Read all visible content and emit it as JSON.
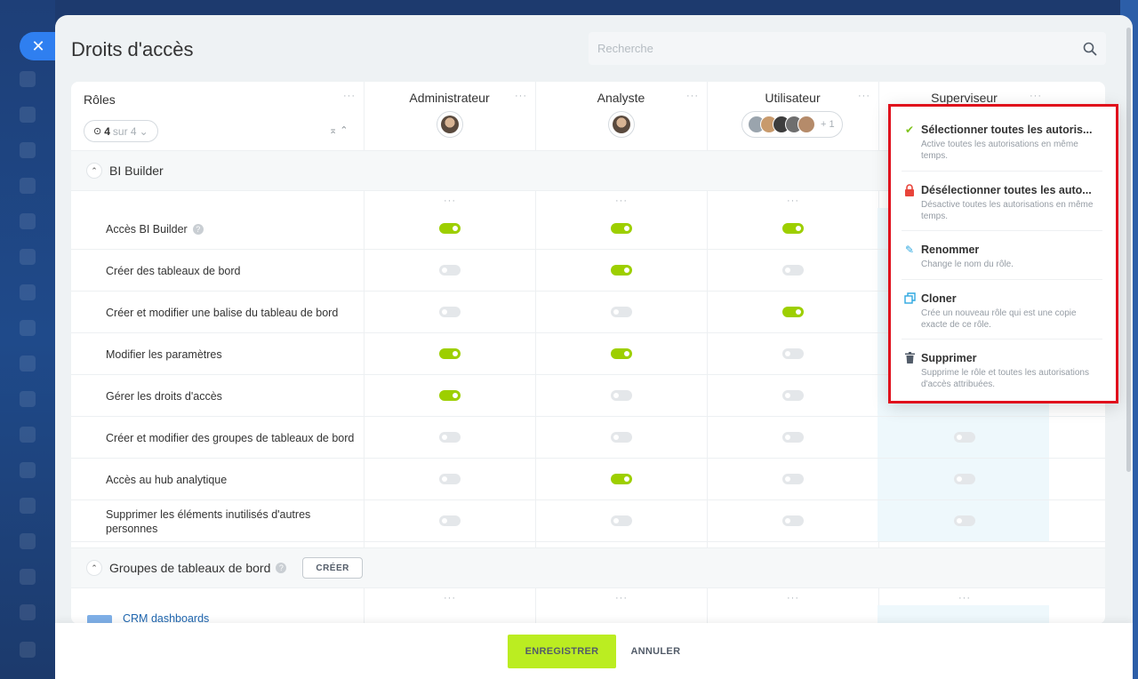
{
  "page": {
    "title": "Droits d'accès",
    "search_placeholder": "Recherche"
  },
  "roles_column": {
    "label": "Rôles",
    "count_current": "4",
    "count_suffix": "sur 4"
  },
  "columns": [
    {
      "name": "Administrateur"
    },
    {
      "name": "Analyste"
    },
    {
      "name": "Utilisateur",
      "extra_count": "+ 1"
    },
    {
      "name": "Superviseur"
    }
  ],
  "sections": [
    {
      "title": "BI Builder",
      "rows": [
        {
          "label": "Accès BI Builder",
          "help": true,
          "values": [
            true,
            true,
            true,
            null
          ]
        },
        {
          "label": "Créer des tableaux de bord",
          "values": [
            false,
            true,
            false,
            null
          ]
        },
        {
          "label": "Créer et modifier une balise du tableau de bord",
          "values": [
            false,
            false,
            true,
            null
          ]
        },
        {
          "label": "Modifier les paramètres",
          "values": [
            true,
            true,
            false,
            null
          ]
        },
        {
          "label": "Gérer les droits d'accès",
          "values": [
            true,
            false,
            false,
            null
          ]
        },
        {
          "label": "Créer et modifier des groupes de tableaux de bord",
          "values": [
            false,
            false,
            false,
            false
          ]
        },
        {
          "label": "Accès au hub analytique",
          "values": [
            false,
            true,
            false,
            false
          ]
        },
        {
          "label": "Supprimer les éléments inutilisés d'autres personnes",
          "values": [
            false,
            false,
            false,
            false
          ]
        }
      ]
    },
    {
      "title": "Groupes de tableaux de bord",
      "create_label": "CRÉER",
      "rows": [
        {
          "label": "CRM dashboards"
        }
      ]
    }
  ],
  "context_menu": {
    "items": [
      {
        "icon": "check-icon",
        "title": "Sélectionner toutes les autoris...",
        "desc": "Active toutes les autorisations en même temps.",
        "color": "#7fc31c"
      },
      {
        "icon": "lock-icon",
        "title": "Désélectionner toutes les auto...",
        "desc": "Désactive toutes les autorisations en même temps.",
        "color": "#e8443a"
      },
      {
        "icon": "pencil-icon",
        "title": "Renommer",
        "desc": "Change le nom du rôle.",
        "color": "#2fa8e0"
      },
      {
        "icon": "copy-icon",
        "title": "Cloner",
        "desc": "Crée un nouveau rôle qui est une copie exacte de ce rôle.",
        "color": "#2fa8e0"
      },
      {
        "icon": "trash-icon",
        "title": "Supprimer",
        "desc": "Supprime le rôle et toutes les autorisations d'accès attribuées.",
        "color": "#525c69"
      }
    ]
  },
  "footer": {
    "save_label": "ENREGISTRER",
    "cancel_label": "ANNULER"
  },
  "colors": {
    "toggle_on": "#9dcf00",
    "toggle_off": "#e4e7ea",
    "save_button": "#bbed21",
    "highlight": "#e0101c"
  }
}
